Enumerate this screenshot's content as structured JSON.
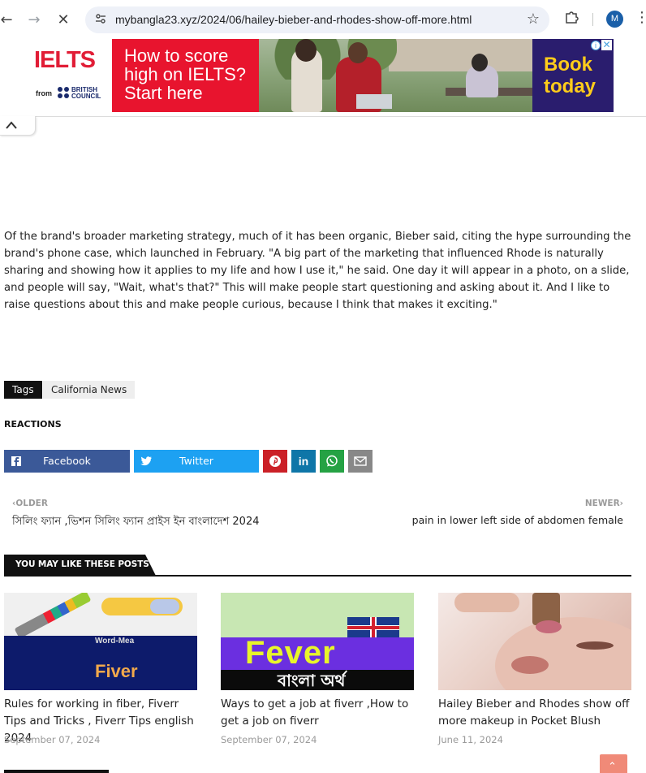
{
  "browser": {
    "url": "mybangla23.xyz/2024/06/hailey-bieber-and-rhodes-show-off-more.html",
    "profile_initial": "M"
  },
  "ad": {
    "brand": "IELTS",
    "from_label": "from",
    "council_label": "BRITISH COUNCIL",
    "headline": "How to score high on IELTS? Start here",
    "cta": "Book today",
    "colors": {
      "red": "#e8142e",
      "purple": "#2a1d6e",
      "yellow": "#ffcc1a"
    }
  },
  "article": {
    "paragraph": "Of the brand's broader marketing strategy, much of it has been organic, Bieber said, citing the hype surrounding the brand's phone case, which launched in February. \"A big part of the marketing that influenced Rhode is naturally sharing and showing how it applies to my life and how I use it,\" he said. One day it will appear in a photo, on a slide, and people will say, \"Wait, what's that?\" This will make people start questioning and asking about it. And I like to raise questions about this and make people curious, because I think that makes it exciting.\""
  },
  "tags": {
    "label": "Tags",
    "items": [
      "California News"
    ]
  },
  "reactions": {
    "heading": "REACTIONS"
  },
  "share": {
    "facebook_label": "Facebook",
    "twitter_label": "Twitter",
    "colors": {
      "facebook": "#3b5998",
      "twitter": "#1da1f2",
      "pinterest": "#cb2027",
      "linkedin": "#0e76a8",
      "whatsapp": "#25a244",
      "email": "#888888"
    }
  },
  "pager": {
    "older_label": "OLDER",
    "older_title": "সিলিং ফ্যান ,ভিশন সিলিং ফ্যান প্রাইস ইন বাংলাদেশ 2024",
    "newer_label": "NEWER",
    "newer_title": "pain in lower left side of abdomen female"
  },
  "related": {
    "heading": "YOU MAY LIKE THESE POSTS",
    "posts": [
      {
        "title": "Rules for working in fiber, Fiverr Tips and Tricks , Fiverr Tips english 2024",
        "date": "September 07, 2024",
        "thumb_text_1": "Word-Mea",
        "thumb_text_2": "Fiver"
      },
      {
        "title": "Ways to get a job at fiverr ,How to get a job on fiverr",
        "date": "September 07, 2024",
        "thumb_text_1": "Fever",
        "thumb_text_2": "বাংলা অর্থ"
      },
      {
        "title": "Hailey Bieber and Rhodes show off more makeup in Pocket Blush",
        "date": "June 11, 2024"
      }
    ]
  }
}
